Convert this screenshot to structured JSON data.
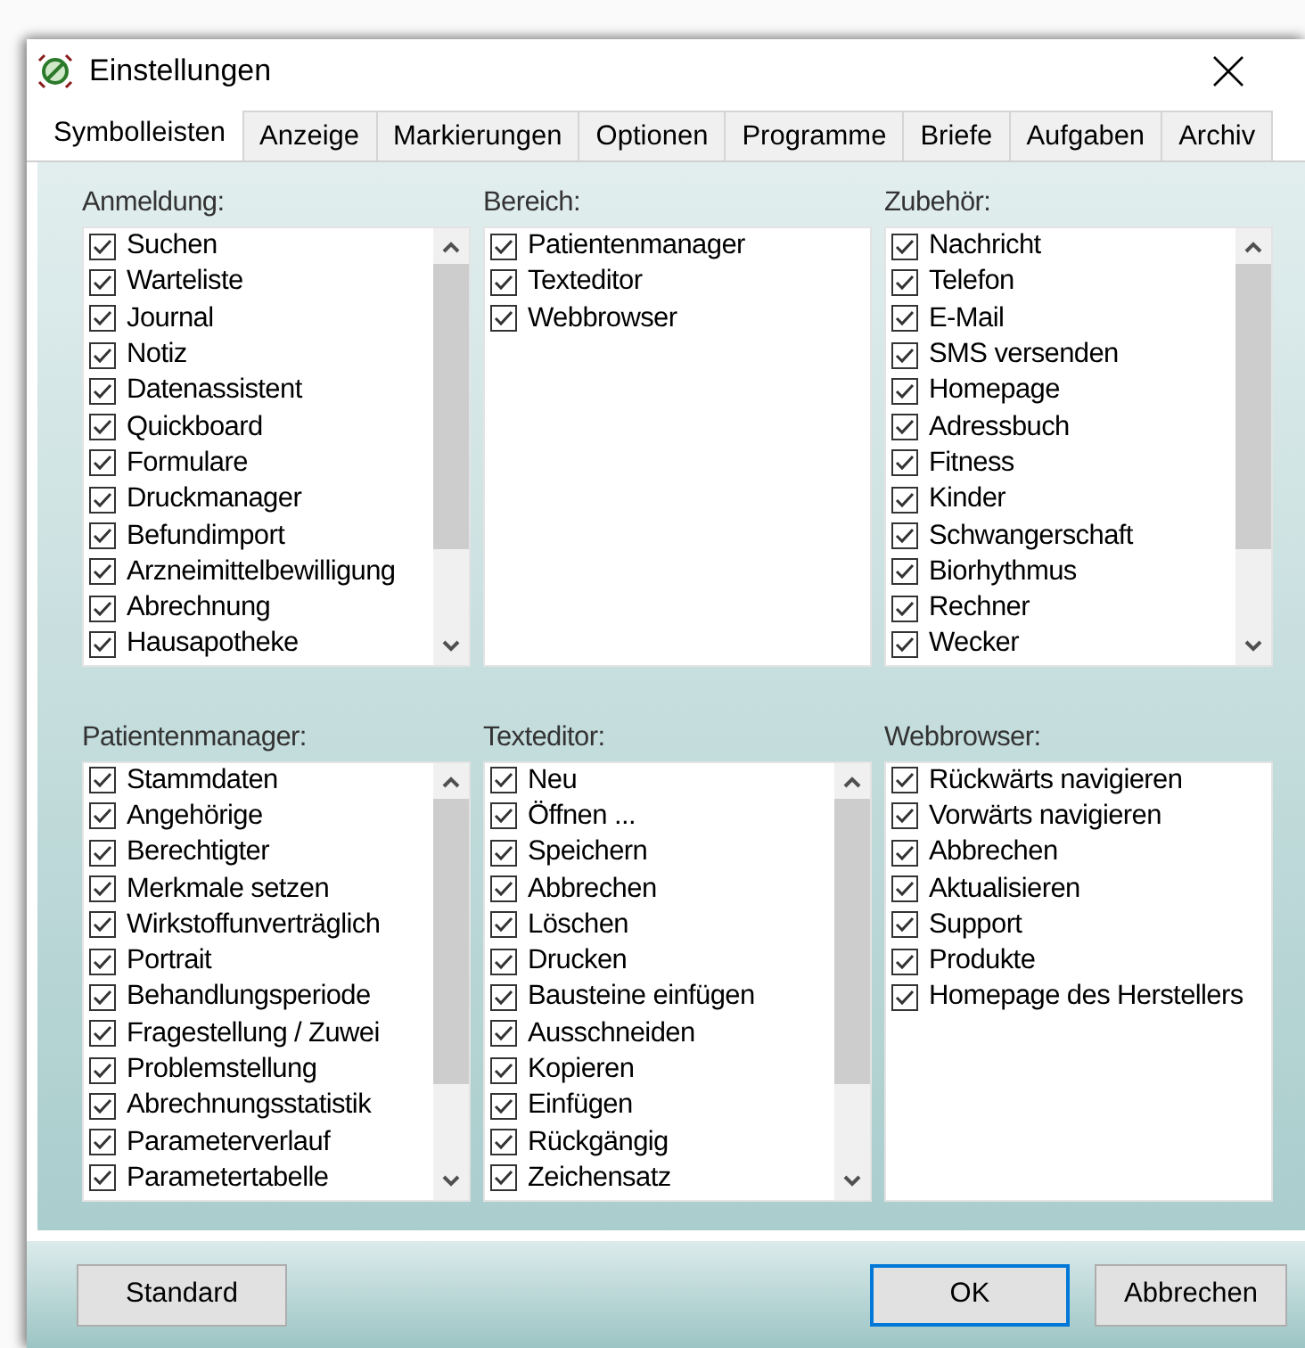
{
  "window": {
    "title": "Einstellungen"
  },
  "tabs": [
    {
      "label": "Symbolleisten",
      "selected": true
    },
    {
      "label": "Anzeige",
      "selected": false
    },
    {
      "label": "Markierungen",
      "selected": false
    },
    {
      "label": "Optionen",
      "selected": false
    },
    {
      "label": "Programme",
      "selected": false
    },
    {
      "label": "Briefe",
      "selected": false
    },
    {
      "label": "Aufgaben",
      "selected": false
    },
    {
      "label": "Archiv",
      "selected": false
    }
  ],
  "groups": [
    {
      "title": "Anmeldung:",
      "scrollbar": true,
      "items": [
        {
          "label": "Suchen",
          "checked": true
        },
        {
          "label": "Warteliste",
          "checked": true
        },
        {
          "label": "Journal",
          "checked": true
        },
        {
          "label": "Notiz",
          "checked": true
        },
        {
          "label": "Datenassistent",
          "checked": true
        },
        {
          "label": "Quickboard",
          "checked": true
        },
        {
          "label": "Formulare",
          "checked": true
        },
        {
          "label": "Druckmanager",
          "checked": true
        },
        {
          "label": "Befundimport",
          "checked": true
        },
        {
          "label": "Arzneimittelbewilligung",
          "checked": true
        },
        {
          "label": "Abrechnung",
          "checked": true
        },
        {
          "label": "Hausapotheke",
          "checked": true
        }
      ]
    },
    {
      "title": "Bereich:",
      "scrollbar": false,
      "items": [
        {
          "label": "Patientenmanager",
          "checked": true
        },
        {
          "label": "Texteditor",
          "checked": true
        },
        {
          "label": "Webbrowser",
          "checked": true
        }
      ]
    },
    {
      "title": "Zubehör:",
      "scrollbar": true,
      "items": [
        {
          "label": "Nachricht",
          "checked": true
        },
        {
          "label": "Telefon",
          "checked": true
        },
        {
          "label": "E-Mail",
          "checked": true
        },
        {
          "label": "SMS versenden",
          "checked": true
        },
        {
          "label": "Homepage",
          "checked": true
        },
        {
          "label": "Adressbuch",
          "checked": true
        },
        {
          "label": "Fitness",
          "checked": true
        },
        {
          "label": "Kinder",
          "checked": true
        },
        {
          "label": "Schwangerschaft",
          "checked": true
        },
        {
          "label": "Biorhythmus",
          "checked": true
        },
        {
          "label": "Rechner",
          "checked": true
        },
        {
          "label": "Wecker",
          "checked": true
        }
      ]
    },
    {
      "title": "Patientenmanager:",
      "scrollbar": true,
      "items": [
        {
          "label": "Stammdaten",
          "checked": true
        },
        {
          "label": "Angehörige",
          "checked": true
        },
        {
          "label": "Berechtigter",
          "checked": true
        },
        {
          "label": "Merkmale setzen",
          "checked": true
        },
        {
          "label": "Wirkstoffunverträglich",
          "checked": true
        },
        {
          "label": "Portrait",
          "checked": true
        },
        {
          "label": "Behandlungsperiode",
          "checked": true
        },
        {
          "label": "Fragestellung / Zuwei",
          "checked": true
        },
        {
          "label": "Problemstellung",
          "checked": true
        },
        {
          "label": "Abrechnungsstatistik",
          "checked": true
        },
        {
          "label": "Parameterverlauf",
          "checked": true
        },
        {
          "label": "Parametertabelle",
          "checked": true
        }
      ]
    },
    {
      "title": "Texteditor:",
      "scrollbar": true,
      "items": [
        {
          "label": "Neu",
          "checked": true
        },
        {
          "label": "Öffnen ...",
          "checked": true
        },
        {
          "label": "Speichern",
          "checked": true
        },
        {
          "label": "Abbrechen",
          "checked": true
        },
        {
          "label": "Löschen",
          "checked": true
        },
        {
          "label": "Drucken",
          "checked": true
        },
        {
          "label": "Bausteine einfügen",
          "checked": true
        },
        {
          "label": "Ausschneiden",
          "checked": true
        },
        {
          "label": "Kopieren",
          "checked": true
        },
        {
          "label": "Einfügen",
          "checked": true
        },
        {
          "label": "Rückgängig",
          "checked": true
        },
        {
          "label": "Zeichensatz",
          "checked": true
        }
      ]
    },
    {
      "title": "Webbrowser:",
      "scrollbar": false,
      "items": [
        {
          "label": "Rückwärts navigieren",
          "checked": true
        },
        {
          "label": "Vorwärts navigieren",
          "checked": true
        },
        {
          "label": "Abbrechen",
          "checked": true
        },
        {
          "label": "Aktualisieren",
          "checked": true
        },
        {
          "label": "Support",
          "checked": true
        },
        {
          "label": "Produkte",
          "checked": true
        },
        {
          "label": "Homepage des Herstellers",
          "checked": true
        }
      ]
    }
  ],
  "buttons": [
    {
      "label": "Standard",
      "kind": "secondary"
    },
    {
      "label": "OK",
      "kind": "default"
    },
    {
      "label": "Abbrechen",
      "kind": "secondary"
    }
  ]
}
